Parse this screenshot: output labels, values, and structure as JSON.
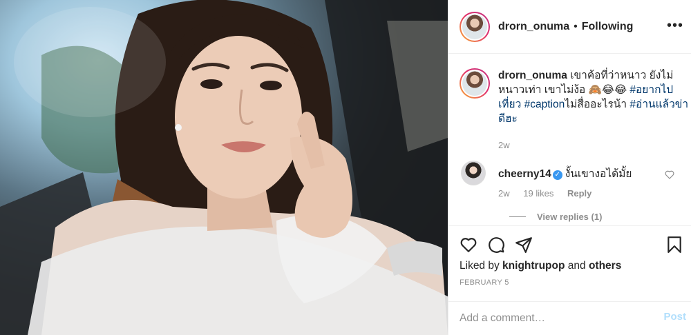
{
  "post": {
    "image_alt": "selfie photo of a woman in a car",
    "header": {
      "username": "drorn_onuma",
      "separator": "•",
      "follow_status": "Following",
      "more_icon": "more-horizontal-icon"
    },
    "caption": {
      "username": "drorn_onuma",
      "text_1": "เขาค้อที่ว่าหนาว ยังไม่หนาวเท่า เขาไม่ง้อ 🙈😂😂",
      "hashtag_1": "#อยากไปเที่ยว",
      "hashtag_2": "#caption",
      "text_2": "ไม่สื่ออะไรน้า",
      "hashtag_3": "#อ่านแล้วข่าดีฮะ",
      "time": "2w"
    },
    "comment": {
      "username": "cheerny14",
      "verified_mark": "✓",
      "text": "งั้นเขางอได้มั้ย",
      "time": "2w",
      "likes": "19 likes",
      "reply_label": "Reply",
      "view_replies": "View replies (1)"
    },
    "actions": {
      "icons": [
        "heart-icon",
        "comment-icon",
        "share-icon",
        "bookmark-icon"
      ]
    },
    "liked_by": {
      "prefix": "Liked by",
      "user": "knightrupop",
      "connector": "and",
      "others": "others"
    },
    "date": "FEBRUARY 5",
    "add_comment": {
      "placeholder": "Add a comment…",
      "post_label": "Post"
    }
  },
  "colors": {
    "link": "#00376b",
    "muted": "#8e8e8e",
    "verified": "#3897f0",
    "post_disabled": "#b2dffc"
  }
}
